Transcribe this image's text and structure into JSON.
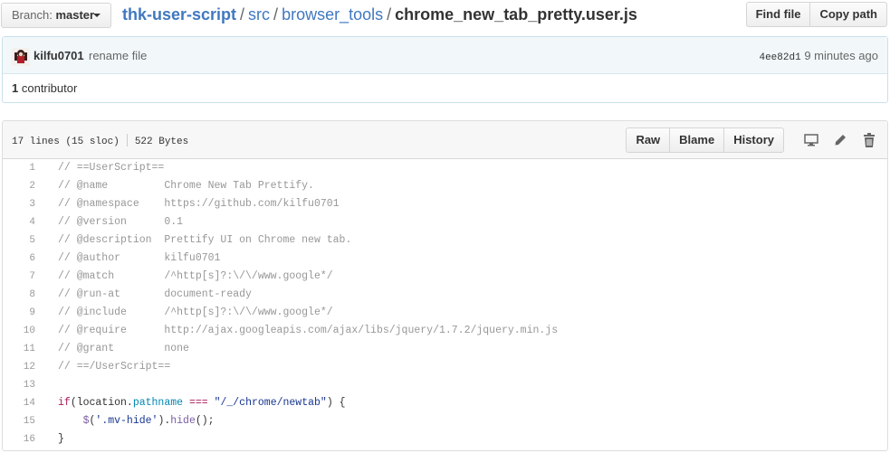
{
  "branch": {
    "label": "Branch:",
    "value": "master"
  },
  "breadcrumb": {
    "repo": "thk-user-script",
    "sep1": "/",
    "dir1": "src",
    "sep2": "/",
    "dir2": "browser_tools",
    "sep3": "/",
    "file": "chrome_new_tab_pretty.user.js"
  },
  "file_buttons": {
    "find": "Find file",
    "copy": "Copy path"
  },
  "commit": {
    "author": "kilfu0701",
    "message": "rename file",
    "sha": "4ee82d1",
    "ago": "9 minutes ago",
    "contributors_count": "1",
    "contributors_label": "contributor"
  },
  "file": {
    "lines": "17 lines (15 sloc)",
    "size": "522 Bytes",
    "actions": {
      "raw": "Raw",
      "blame": "Blame",
      "history": "History"
    }
  },
  "icons": [
    "desktop-icon",
    "pencil-icon",
    "trash-icon"
  ],
  "code": [
    {
      "n": "1",
      "parts": [
        [
          "c-com",
          "// ==UserScript=="
        ]
      ]
    },
    {
      "n": "2",
      "parts": [
        [
          "c-com",
          "// @name         Chrome New Tab Prettify."
        ]
      ]
    },
    {
      "n": "3",
      "parts": [
        [
          "c-com",
          "// @namespace    https://github.com/kilfu0701"
        ]
      ]
    },
    {
      "n": "4",
      "parts": [
        [
          "c-com",
          "// @version      0.1"
        ]
      ]
    },
    {
      "n": "5",
      "parts": [
        [
          "c-com",
          "// @description  Prettify UI on Chrome new tab."
        ]
      ]
    },
    {
      "n": "6",
      "parts": [
        [
          "c-com",
          "// @author       kilfu0701"
        ]
      ]
    },
    {
      "n": "7",
      "parts": [
        [
          "c-com",
          "// @match        /^http[s]?:\\/\\/www.google*/"
        ]
      ]
    },
    {
      "n": "8",
      "parts": [
        [
          "c-com",
          "// @run-at       document-ready"
        ]
      ]
    },
    {
      "n": "9",
      "parts": [
        [
          "c-com",
          "// @include      /^http[s]?:\\/\\/www.google*/"
        ]
      ]
    },
    {
      "n": "10",
      "parts": [
        [
          "c-com",
          "// @require      http://ajax.googleapis.com/ajax/libs/jquery/1.7.2/jquery.min.js"
        ]
      ]
    },
    {
      "n": "11",
      "parts": [
        [
          "c-com",
          "// @grant        none"
        ]
      ]
    },
    {
      "n": "12",
      "parts": [
        [
          "c-com",
          "// ==/UserScript=="
        ]
      ]
    },
    {
      "n": "13",
      "parts": []
    },
    {
      "n": "14",
      "parts": [
        [
          "c-kw",
          "if"
        ],
        [
          "",
          "(location."
        ],
        [
          "c-prop",
          "pathname"
        ],
        [
          "",
          " "
        ],
        [
          "c-kw",
          "==="
        ],
        [
          "",
          " "
        ],
        [
          "c-str",
          "\"/_/chrome/newtab\""
        ],
        [
          "",
          ") {"
        ]
      ]
    },
    {
      "n": "15",
      "parts": [
        [
          "",
          "    "
        ],
        [
          "c-fn",
          "$"
        ],
        [
          "",
          "("
        ],
        [
          "c-str",
          "'.mv-hide'"
        ],
        [
          "",
          ")."
        ],
        [
          "c-fn",
          "hide"
        ],
        [
          "",
          "();"
        ]
      ]
    },
    {
      "n": "16",
      "parts": [
        [
          "",
          "}"
        ]
      ]
    }
  ]
}
